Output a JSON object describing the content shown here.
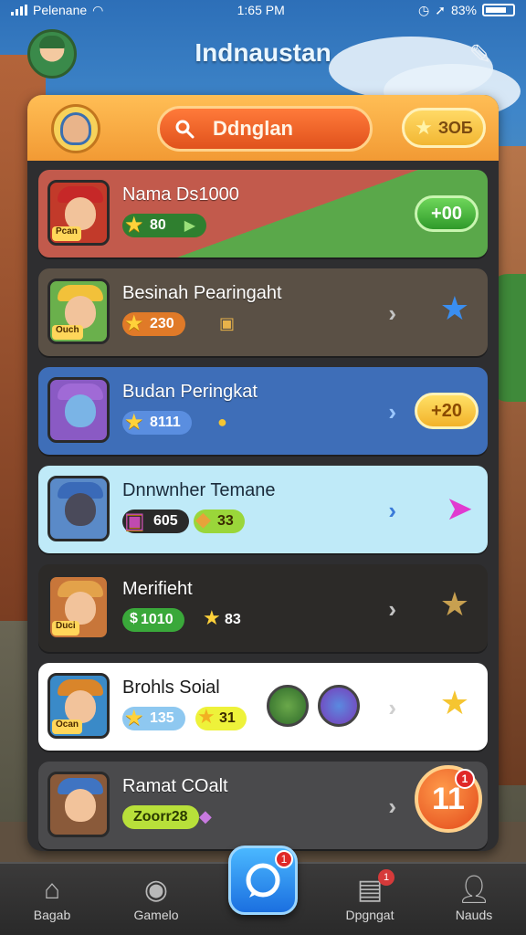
{
  "status_bar": {
    "carrier": "Pelenane",
    "time": "1:65 PM",
    "battery": "83%"
  },
  "header": {
    "title": "Indnaustan"
  },
  "panel": {
    "search_label": "Ddnglan",
    "coins": "ЗОБ"
  },
  "rows": [
    {
      "title": "Nama Ds1000",
      "portrait_tag": "Pcan",
      "stat_value": "80",
      "action_label": "+00"
    },
    {
      "title": "Besinah Pearingaht",
      "portrait_tag": "Ouch",
      "stat_value": "230"
    },
    {
      "title": "Budan Peringkat",
      "stat_value": "8111",
      "action_label": "+20"
    },
    {
      "title": "Dnnwnher Temane",
      "stat_value": "605",
      "stat2_value": "33"
    },
    {
      "title": "Merifieht",
      "portrait_tag": "Duci",
      "stat_value": "1010",
      "stat2_value": "83"
    },
    {
      "title": "Brohls Soial",
      "portrait_tag": "Ocan",
      "stat_value": "135",
      "stat2_value": "31"
    },
    {
      "title": "Ramat COalt",
      "stat_value": "Zoorr28",
      "action_label": "11",
      "badge": "1"
    }
  ],
  "bottom_nav": {
    "items": [
      {
        "label": "Bagab"
      },
      {
        "label": "Gamelo"
      },
      {
        "label": "Dpgngat",
        "badge": "1"
      },
      {
        "label": "Nauds"
      }
    ],
    "center_badge": "1"
  },
  "colors": {
    "accent_orange": "#f29a34",
    "action_green": "#3fae3a",
    "action_yellow": "#f5c531",
    "panel_dark": "#2e2e30"
  }
}
